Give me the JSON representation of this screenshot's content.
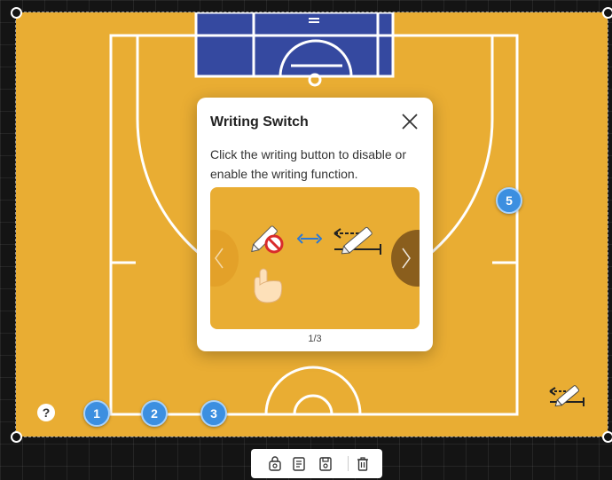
{
  "dialog": {
    "title": "Writing Switch",
    "description": "Click the writing button to disable or enable the writing function.",
    "pager": "1/3"
  },
  "players": [
    {
      "label": "1"
    },
    {
      "label": "2"
    },
    {
      "label": "3"
    },
    {
      "label": "5"
    }
  ],
  "help": {
    "label": "?"
  },
  "toolbar": {
    "items": [
      "lock-icon",
      "notes-icon",
      "save-icon",
      "trash-icon"
    ]
  },
  "colors": {
    "court": "#e9ad33",
    "paint": "#3549a0",
    "player": "#3c8fe0",
    "lines": "#ffffff",
    "background": "#141414"
  }
}
